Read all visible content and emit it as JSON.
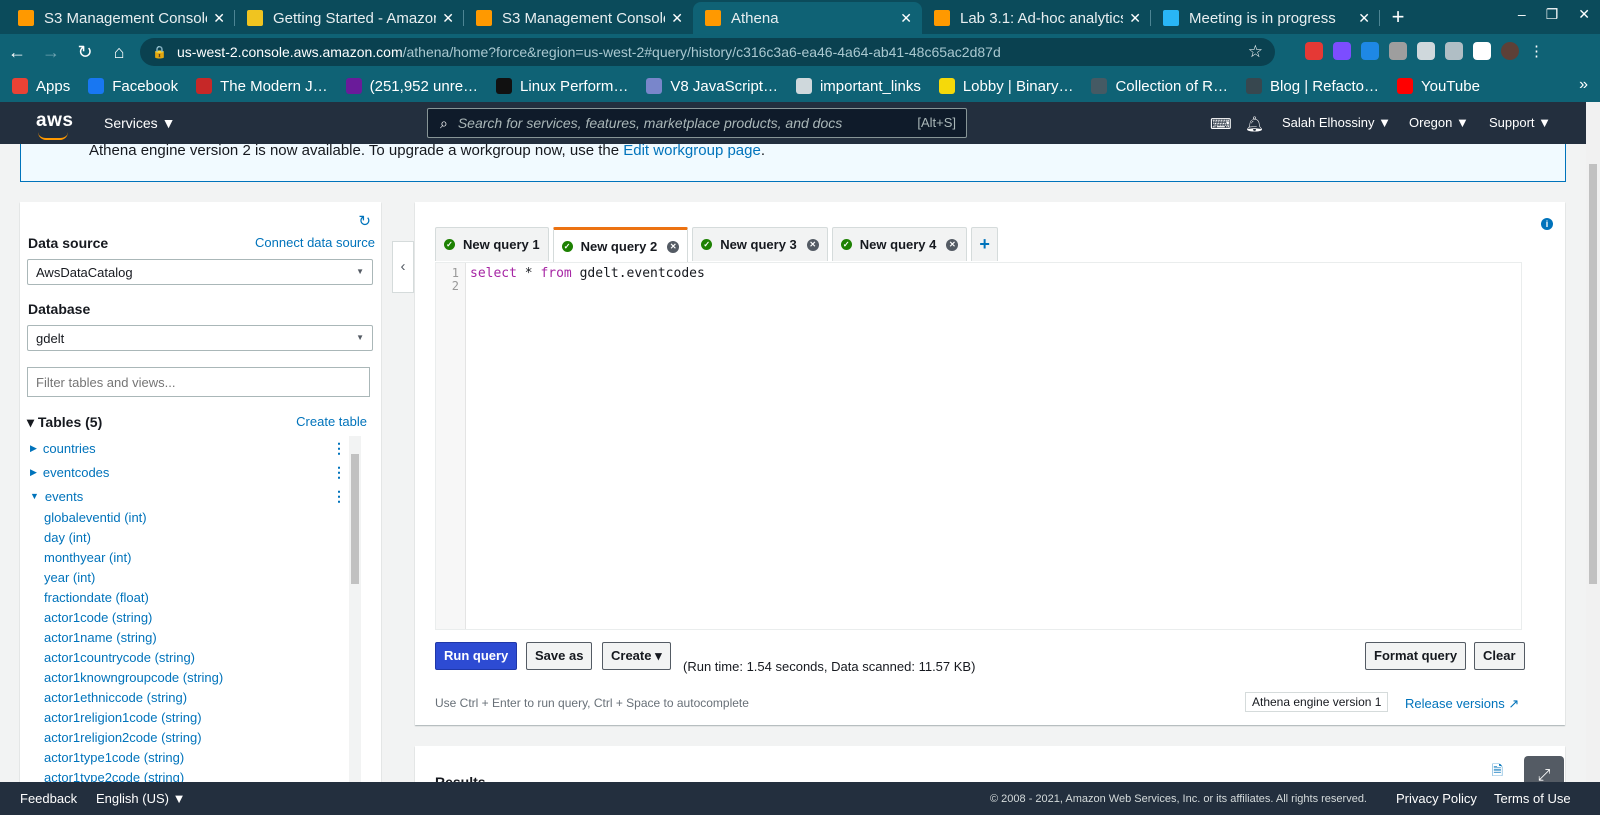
{
  "browser": {
    "tabs": [
      {
        "title": "S3 Management Console",
        "icon": "aws-icon",
        "color": "#ff9900"
      },
      {
        "title": "Getting Started - Amazon",
        "icon": "box-icon",
        "color": "#f0c420"
      },
      {
        "title": "S3 Management Console",
        "icon": "aws-icon",
        "color": "#ff9900"
      },
      {
        "title": "Athena",
        "icon": "aws-icon",
        "color": "#ff9900"
      },
      {
        "title": "Lab 3.1: Ad-hoc analytics",
        "icon": "aws-icon",
        "color": "#ff9900"
      },
      {
        "title": "Meeting is in progress",
        "icon": "meeting-icon",
        "color": "#29b6f6"
      }
    ],
    "new_tab": "+",
    "url_host": "us-west-2.console.aws.amazon.com",
    "url_path": "/athena/home?force&region=us-west-2#query/history/c316c3a6-ea46-4a64-ab41-48c65ac2d87d",
    "bookmarks": [
      {
        "label": "Apps",
        "color": "#e94235"
      },
      {
        "label": "Facebook",
        "color": "#1877f2"
      },
      {
        "label": "The Modern J…",
        "color": "#c62828"
      },
      {
        "label": "(251,952 unre…",
        "color": "#6a1b9a"
      },
      {
        "label": "Linux Perform…",
        "color": "#111111"
      },
      {
        "label": "V8 JavaScript…",
        "color": "#7986cb"
      },
      {
        "label": "important_links",
        "color": "#cfd8dc"
      },
      {
        "label": "Lobby | Binary…",
        "color": "#f5d90a"
      },
      {
        "label": "Collection of R…",
        "color": "#455a64"
      },
      {
        "label": "Blog | Refacto…",
        "color": "#37474f"
      },
      {
        "label": "YouTube",
        "color": "#ff0000"
      }
    ]
  },
  "aws": {
    "logo": "aws",
    "services": "Services ▼",
    "search_placeholder": "Search for services, features, marketplace products, and docs",
    "search_shortcut": "[Alt+S]",
    "user": "Salah Elhossiny ▼",
    "region": "Oregon ▼",
    "support": "Support ▼"
  },
  "banner": {
    "text": "Athena engine version 2 is now available. To upgrade a workgroup now, use the ",
    "link": "Edit workgroup page",
    "tail": "."
  },
  "sidebar": {
    "data_source_label": "Data source",
    "connect_link": "Connect data source",
    "data_source_value": "AwsDataCatalog",
    "database_label": "Database",
    "database_value": "gdelt",
    "filter_placeholder": "Filter tables and views...",
    "tables_header": "Tables (5)",
    "create_table": "Create table",
    "tables": [
      "countries",
      "eventcodes",
      "events"
    ],
    "columns": [
      "globaleventid (int)",
      "day (int)",
      "monthyear (int)",
      "year (int)",
      "fractiondate (float)",
      "actor1code (string)",
      "actor1name (string)",
      "actor1countrycode (string)",
      "actor1knowngroupcode (string)",
      "actor1ethniccode (string)",
      "actor1religion1code (string)",
      "actor1religion2code (string)",
      "actor1type1code (string)",
      "actor1type2code (string)"
    ]
  },
  "editor": {
    "tabs": [
      "New query 1",
      "New query 2",
      "New query 3",
      "New query 4"
    ],
    "lines": [
      "1",
      "2"
    ],
    "code_kw1": "select",
    "code_mid": " * ",
    "code_kw2": "from",
    "code_rest": " gdelt.eventcodes",
    "run_query": "Run query",
    "save_as": "Save as",
    "create": "Create ▾",
    "run_info": "(Run time: 1.54 seconds, Data scanned: 11.57 KB)",
    "format_query": "Format query",
    "clear": "Clear",
    "hint": "Use Ctrl + Enter to run query, Ctrl + Space to autocomplete",
    "engine": "Athena engine version 1",
    "release": "Release versions"
  },
  "results": {
    "title": "Results"
  },
  "footer": {
    "feedback": "Feedback",
    "language": "English (US) ▼",
    "copyright": "© 2008 - 2021, Amazon Web Services, Inc. or its affiliates. All rights reserved.",
    "privacy": "Privacy Policy",
    "terms": "Terms of Use"
  }
}
